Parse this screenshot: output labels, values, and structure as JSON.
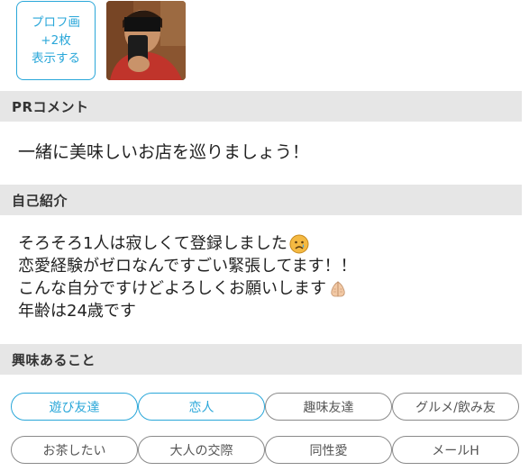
{
  "profile": {
    "more_photos_lines": [
      "プロフ画",
      "+2枚",
      "表示する"
    ]
  },
  "sections": {
    "pr_title": "PRコメント",
    "pr_text": "一緒に美味しいお店を巡りましょう！",
    "intro_title": "自己紹介",
    "intro_lines": [
      {
        "text": "そろそろ1人は寂しくて登録しました",
        "emoji": "sad-face-emoji"
      },
      {
        "text": "恋愛経験がゼロなんですごい緊張してます！！",
        "emoji": ""
      },
      {
        "text": "こんな自分ですけどよろしくお願いします",
        "emoji": "praying-hands-emoji"
      },
      {
        "text": "年齢は24歳です",
        "emoji": ""
      }
    ],
    "interests_title": "興味あること"
  },
  "interests": [
    {
      "label": "遊び友達",
      "active": true
    },
    {
      "label": "恋人",
      "active": true
    },
    {
      "label": "趣味友達",
      "active": false
    },
    {
      "label": "グルメ/飲み友",
      "active": false
    },
    {
      "label": "お茶したい",
      "active": false
    },
    {
      "label": "大人の交際",
      "active": false
    },
    {
      "label": "同性愛",
      "active": false
    },
    {
      "label": "メールH",
      "active": false
    }
  ],
  "colors": {
    "accent": "#2aa7d9",
    "header_bg": "#e6e6e6",
    "tag_border": "#8a8a8a"
  }
}
